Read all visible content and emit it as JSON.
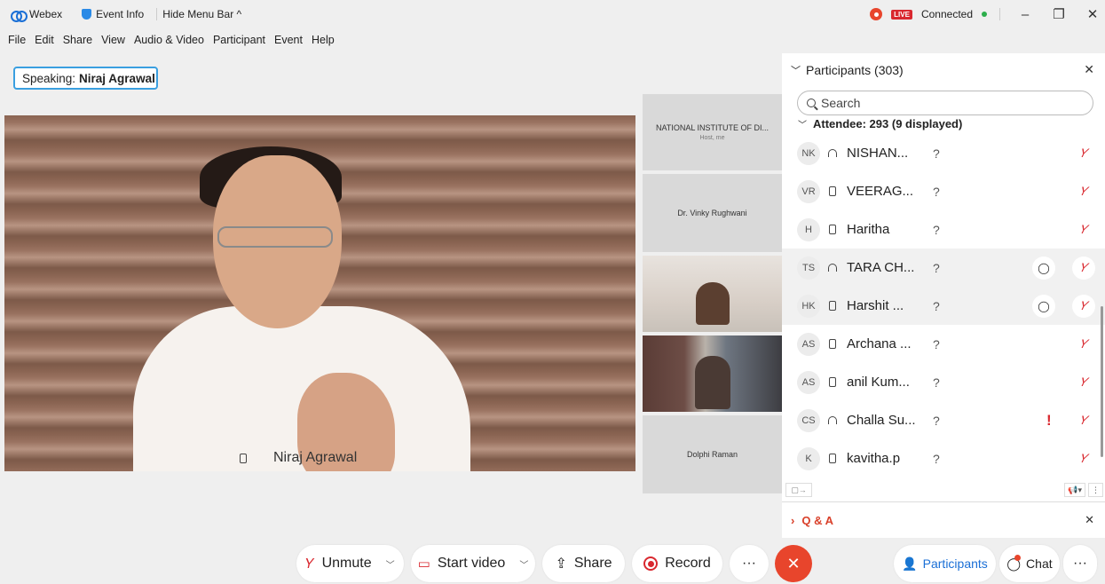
{
  "titlebar": {
    "app_name": "Webex",
    "event_info": "Event Info",
    "hide_menu": "Hide Menu Bar ^",
    "live_badge": "LIVE",
    "status": "Connected",
    "minimize": "–",
    "restore": "❐",
    "close": "✕"
  },
  "menu": {
    "file": "File",
    "edit": "Edit",
    "share": "Share",
    "view": "View",
    "audio_video": "Audio & Video",
    "participant": "Participant",
    "event": "Event",
    "help": "Help"
  },
  "speaking": {
    "prefix": "Speaking:",
    "name": "Niraj Agrawal"
  },
  "main_video": {
    "name": "Niraj Agrawal"
  },
  "tiles": [
    {
      "name": "NATIONAL INSTITUTE OF DI...",
      "sub": "Host, me"
    },
    {
      "name": "Dr. Vinky Rughwani",
      "sub": ""
    },
    {
      "name": "",
      "sub": ""
    },
    {
      "name": "",
      "sub": ""
    },
    {
      "name": "Dolphi Raman",
      "sub": ""
    }
  ],
  "panel": {
    "title": "Participants (303)",
    "search_placeholder": "Search",
    "attendee_header": "Attendee: 293 (9 displayed)",
    "rows": [
      {
        "initials": "NK",
        "name": "NISHAN...",
        "status": "?"
      },
      {
        "initials": "VR",
        "name": "VEERAG...",
        "status": "?"
      },
      {
        "initials": "H",
        "name": "Haritha",
        "status": "?"
      },
      {
        "initials": "TS",
        "name": "TARA CH...",
        "status": "?"
      },
      {
        "initials": "HK",
        "name": "Harshit ...",
        "status": "?"
      },
      {
        "initials": "AS",
        "name": "Archana ...",
        "status": "?"
      },
      {
        "initials": "AS",
        "name": "anil Kum...",
        "status": "?"
      },
      {
        "initials": "CS",
        "name": "Challa Su...",
        "status": "?"
      },
      {
        "initials": "K",
        "name": "kavitha.p",
        "status": "?"
      }
    ],
    "raise_hand": "!",
    "qa_label": "Q & A"
  },
  "toolbar": {
    "unmute": "Unmute",
    "start_video": "Start video",
    "share": "Share",
    "record": "Record",
    "more": "···",
    "end": "✕",
    "participants": "Participants",
    "chat": "Chat",
    "overflow": "···"
  },
  "colors": {
    "accent": "#1a6fd6",
    "danger": "#d9282f",
    "end_call": "#e8452c"
  }
}
